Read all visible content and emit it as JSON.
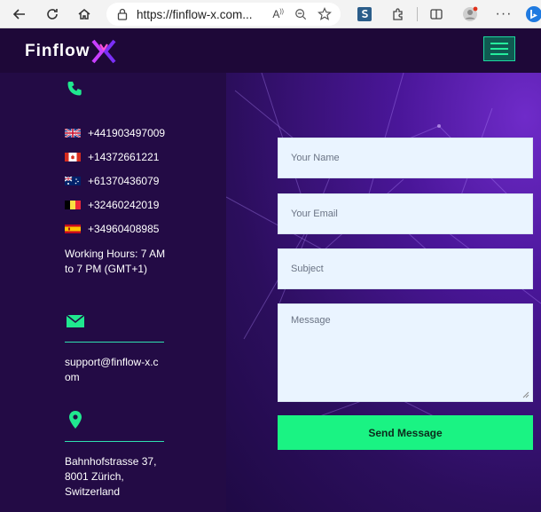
{
  "browser": {
    "url": "https://finflow-x.com...",
    "back_icon": "arrow-left-icon",
    "refresh_icon": "refresh-icon",
    "home_icon": "home-icon"
  },
  "header": {
    "logo_text": "Finflow",
    "accent": "#1af383",
    "brand_purple": "#230b45"
  },
  "contact": {
    "phones": [
      {
        "flag": "uk",
        "number": "+441903497009"
      },
      {
        "flag": "ca",
        "number": "+14372661221"
      },
      {
        "flag": "au",
        "number": "+61370436079"
      },
      {
        "flag": "be",
        "number": "+32460242019"
      },
      {
        "flag": "es",
        "number": "+34960408985"
      }
    ],
    "working_hours": "Working Hours: 7 AM to 7 PM (GMT+1)",
    "email": "support@finflow-x.com",
    "address_line1": "Bahnhofstrasse 37,",
    "address_line2": "8001 Zürich,",
    "address_line3": "Switzerland"
  },
  "form": {
    "name_placeholder": "Your Name",
    "email_placeholder": "Your Email",
    "subject_placeholder": "Subject",
    "message_placeholder": "Message",
    "send_label": "Send Message"
  }
}
